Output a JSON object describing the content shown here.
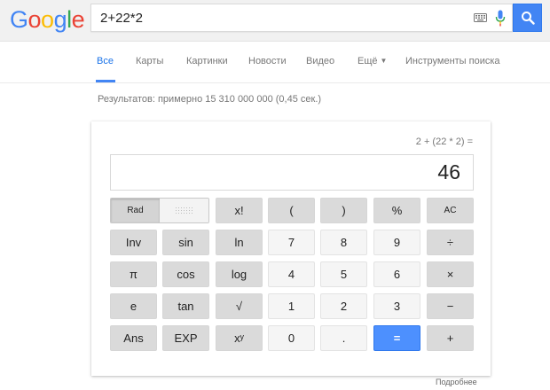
{
  "header": {
    "logo_letters": [
      "G",
      "o",
      "o",
      "g",
      "l",
      "e"
    ],
    "logo_colors": [
      "#4285f4",
      "#ea4335",
      "#fbbc05",
      "#4285f4",
      "#34a853",
      "#ea4335"
    ],
    "search_value": "2+22*2",
    "search_button_color": "#4285f4"
  },
  "tabs": {
    "all": "Все",
    "maps": "Карты",
    "images": "Картинки",
    "news": "Новости",
    "video": "Видео",
    "more": "Ещё",
    "tools": "Инструменты поиска",
    "active_color": "#1a73e8"
  },
  "results": {
    "stats": "Результатов: примерно 15 310 000 000 (0,45 сек.)"
  },
  "calculator": {
    "expression": "2 + (22 * 2) =",
    "result": "46",
    "rad_label": "Rad",
    "keys": {
      "factorial": "x!",
      "lparen": "(",
      "rparen": ")",
      "percent": "%",
      "clear": "AC",
      "inv": "Inv",
      "sin": "sin",
      "ln": "ln",
      "seven": "7",
      "eight": "8",
      "nine": "9",
      "divide": "÷",
      "pi": "π",
      "cos": "cos",
      "log": "log",
      "four": "4",
      "five": "5",
      "six": "6",
      "multiply": "×",
      "e": "e",
      "tan": "tan",
      "sqrt": "√",
      "one": "1",
      "two": "2",
      "three": "3",
      "minus": "−",
      "ans": "Ans",
      "exp": "EXP",
      "power": "xʸ",
      "zero": "0",
      "dot": ".",
      "equals": "=",
      "plus": "+"
    }
  },
  "footer": {
    "more_link": "Подробнее"
  }
}
